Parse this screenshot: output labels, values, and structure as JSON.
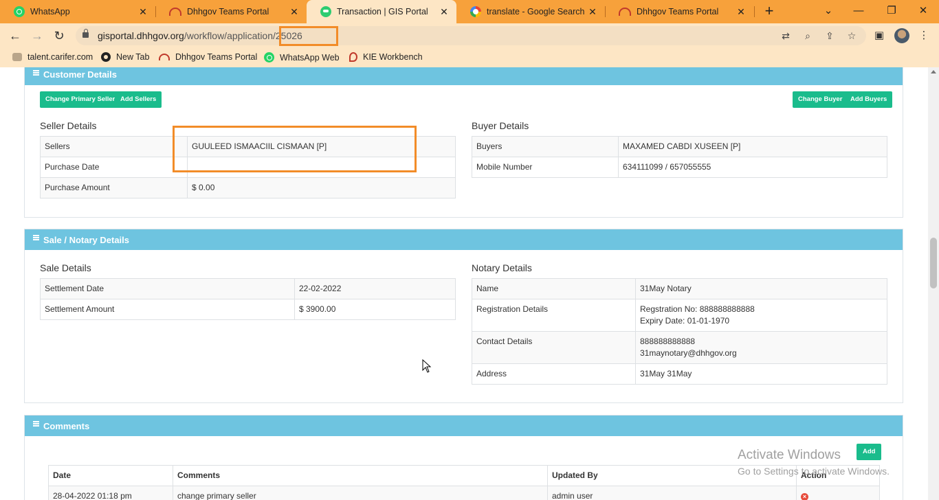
{
  "tabs": [
    {
      "title": "WhatsApp",
      "icon": "whatsapp-icon"
    },
    {
      "title": "Dhhgov Teams Portal",
      "icon": "dhhgov-icon"
    },
    {
      "title": "Transaction | GIS Portal",
      "icon": "gis-icon",
      "active": true
    },
    {
      "title": "translate - Google Search",
      "icon": "google-icon"
    },
    {
      "title": "Dhhgov Teams Portal",
      "icon": "dhhgov-icon"
    }
  ],
  "address": {
    "host": "gisportal.dhhgov.org",
    "path": "/workflow/application/25026"
  },
  "bookmarks": [
    {
      "label": "talent.carifer.com",
      "icon": "talent-icon"
    },
    {
      "label": "New Tab",
      "icon": "globe-icon"
    },
    {
      "label": "Dhhgov Teams Portal",
      "icon": "dhhgov-icon"
    },
    {
      "label": "WhatsApp Web",
      "icon": "whatsapp-icon"
    },
    {
      "label": "KIE Workbench",
      "icon": "kie-icon"
    }
  ],
  "customer": {
    "heading": "Customer Details",
    "buttons": {
      "change_primary_seller": "Change Primary Seller",
      "add_sellers": "Add Sellers",
      "change_buyer": "Change Buyer",
      "add_buyers": "Add Buyers"
    },
    "seller_title": "Seller Details",
    "seller_rows": [
      {
        "label": "Sellers",
        "value": "GUULEED ISMAACIIL CISMAAN [P]"
      },
      {
        "label": "Purchase Date",
        "value": ""
      },
      {
        "label": "Purchase Amount",
        "value": "$ 0.00"
      }
    ],
    "buyer_title": "Buyer Details",
    "buyer_rows": [
      {
        "label": "Buyers",
        "value": "MAXAMED CABDI XUSEEN [P]"
      },
      {
        "label": "Mobile Number",
        "value": "634111099 / 657055555"
      }
    ]
  },
  "sale": {
    "heading": "Sale / Notary Details",
    "sale_title": "Sale Details",
    "sale_rows": [
      {
        "label": "Settlement Date",
        "value": "22-02-2022"
      },
      {
        "label": "Settlement Amount",
        "value": "$ 3900.00"
      }
    ],
    "notary_title": "Notary Details",
    "notary_rows": [
      {
        "label": "Name",
        "value": "31May Notary"
      },
      {
        "label": "Registration Details",
        "value_line1": "Regstration No: 888888888888",
        "value_line2": "Expiry Date: 01-01-1970"
      },
      {
        "label": "Contact Details",
        "value_line1": "888888888888",
        "value_line2": "31maynotary@dhhgov.org"
      },
      {
        "label": "Address",
        "value": "31May 31May"
      }
    ]
  },
  "comments": {
    "heading": "Comments",
    "add_label": "Add",
    "columns": [
      "Date",
      "Comments",
      "Updated By",
      "Action"
    ],
    "rows": [
      {
        "date": "28-04-2022 01:18 pm",
        "comment": "change primary seller",
        "updated_by": "admin user"
      }
    ]
  },
  "watermark": {
    "line1": "Activate Windows",
    "line2": "Go to Settings to activate Windows."
  }
}
